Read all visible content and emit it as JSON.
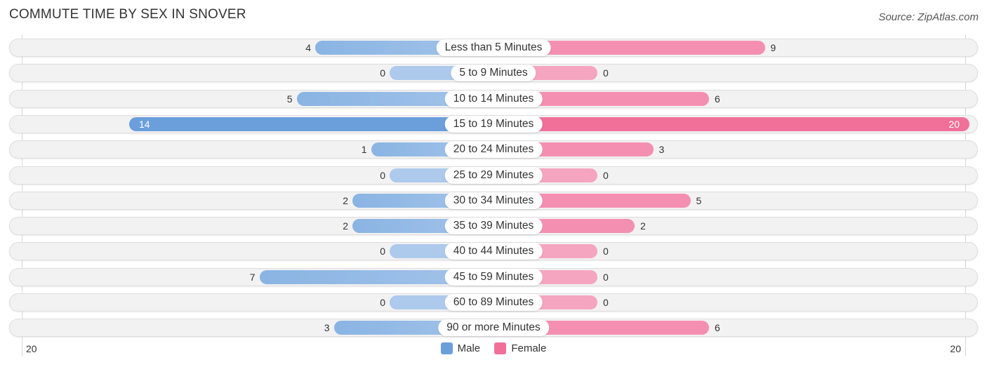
{
  "header": {
    "title": "COMMUTE TIME BY SEX IN SNOVER",
    "source": "Source: ZipAtlas.com"
  },
  "colors": {
    "male": "#6a9fdb",
    "male_light": "#a3c4ea",
    "female": "#f0709a",
    "female_light": "#f5a5c0"
  },
  "chart_data": {
    "type": "bar",
    "orientation": "horizontal-diverging",
    "title": "COMMUTE TIME BY SEX IN SNOVER",
    "categories": [
      "Less than 5 Minutes",
      "5 to 9 Minutes",
      "10 to 14 Minutes",
      "15 to 19 Minutes",
      "20 to 24 Minutes",
      "25 to 29 Minutes",
      "30 to 34 Minutes",
      "35 to 39 Minutes",
      "40 to 44 Minutes",
      "45 to 59 Minutes",
      "60 to 89 Minutes",
      "90 or more Minutes"
    ],
    "series": [
      {
        "name": "Male",
        "values": [
          4,
          0,
          5,
          14,
          1,
          0,
          2,
          2,
          0,
          7,
          0,
          3
        ]
      },
      {
        "name": "Female",
        "values": [
          9,
          0,
          6,
          20,
          3,
          0,
          5,
          2,
          0,
          0,
          0,
          6
        ]
      }
    ],
    "axis": {
      "left_tick": "20",
      "right_tick": "20",
      "max": 20
    },
    "legend": {
      "position": "bottom-center",
      "entries": [
        "Male",
        "Female"
      ]
    }
  }
}
